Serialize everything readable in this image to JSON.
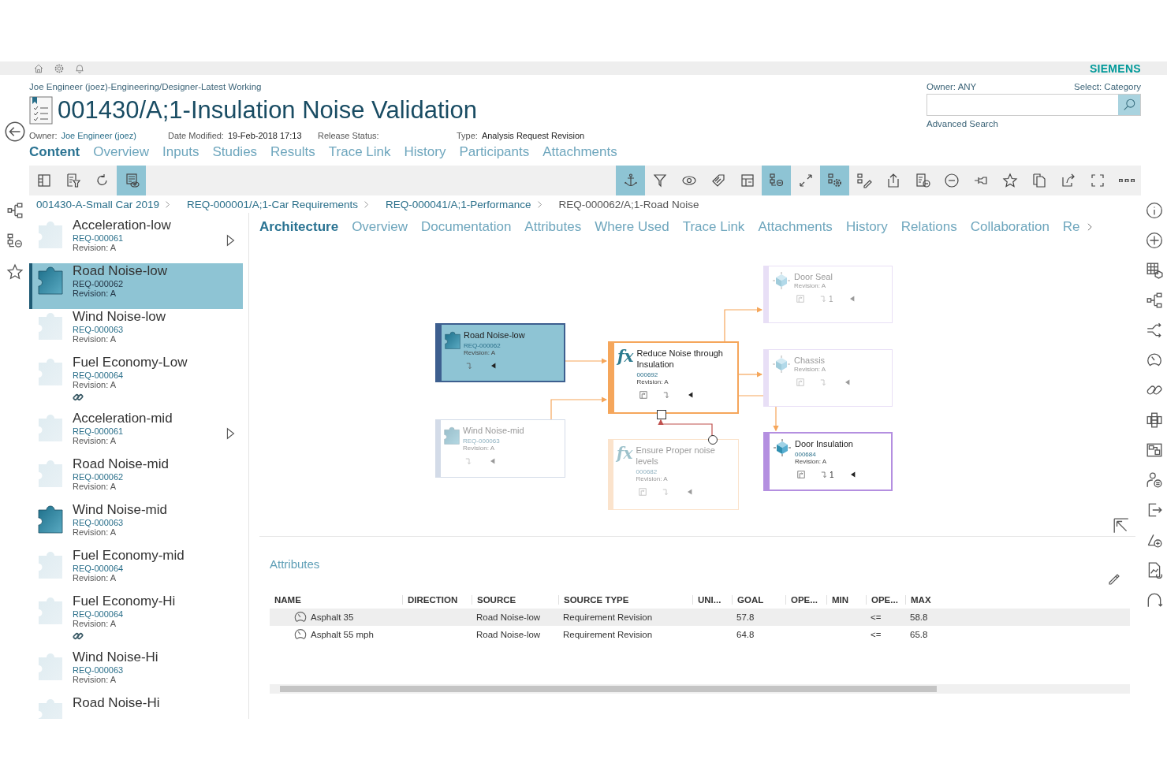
{
  "top_bar": {
    "logo": "SIEMENS"
  },
  "header": {
    "context": "Joe Engineer (joez)-Engineering/Designer-Latest Working",
    "title": "001430/A;1-Insulation Noise Validation",
    "properties": [
      {
        "label": "Owner:",
        "value": "Joe Engineer (joez)",
        "link": true
      },
      {
        "label": "Date Modified:",
        "value": "19-Feb-2018 17:13",
        "link": false
      },
      {
        "label": "Release Status:"
      },
      {
        "label": "Type:",
        "value": "Analysis Request Revision",
        "link": false
      }
    ]
  },
  "search": {
    "owner": "Owner: ANY",
    "select": "Select: Category",
    "advanced": "Advanced Search"
  },
  "page_tabs": [
    {
      "label": "Content",
      "selected": true
    },
    {
      "label": "Overview",
      "selected": false
    },
    {
      "label": "Inputs",
      "selected": false
    },
    {
      "label": "Studies",
      "selected": false
    },
    {
      "label": "Results",
      "selected": false
    },
    {
      "label": "Trace Link",
      "selected": false
    },
    {
      "label": "History",
      "selected": false
    },
    {
      "label": "Participants",
      "selected": false
    },
    {
      "label": "Attachments",
      "selected": false
    }
  ],
  "toolbar": {
    "left": [
      {
        "selected": false
      },
      {
        "selected": false
      },
      {
        "selected": false
      },
      {
        "selected": true
      }
    ],
    "right": [
      {
        "selected": true
      },
      {
        "selected": false
      },
      {
        "selected": false
      },
      {
        "selected": false
      },
      {
        "selected": false
      },
      {
        "selected": true
      },
      {
        "selected": false
      },
      {
        "selected": true
      },
      {
        "selected": false
      },
      {
        "selected": false
      },
      {
        "selected": false
      },
      {
        "selected": false
      },
      {
        "selected": false
      },
      {
        "selected": false
      },
      {
        "selected": false
      },
      {
        "selected": false
      },
      {
        "selected": false
      },
      {
        "selected": false
      }
    ]
  },
  "breadcrumb": [
    "001430-A-Small Car 2019",
    "REQ-000001/A;1-Car Requirements",
    "REQ-000041/A;1-Performance",
    "REQ-000062/A;1-Road Noise"
  ],
  "list": [
    {
      "name": "Acceleration-low",
      "id": "REQ-000061",
      "revision": "Revision:  A",
      "selected": false,
      "active": false,
      "linked": false,
      "expandable": true
    },
    {
      "name": "Road Noise-low",
      "id": "REQ-000062",
      "revision": "Revision:  A",
      "selected": true,
      "active": true,
      "linked": false,
      "expandable": false
    },
    {
      "name": "Wind Noise-low",
      "id": "REQ-000063",
      "revision": "Revision:  A",
      "selected": false,
      "active": false,
      "linked": false,
      "expandable": false
    },
    {
      "name": "Fuel Economy-Low",
      "id": "REQ-000064",
      "revision": "Revision:  A",
      "selected": false,
      "active": false,
      "linked": true,
      "expandable": false
    },
    {
      "name": "Acceleration-mid",
      "id": "REQ-000061",
      "revision": "Revision:  A",
      "selected": false,
      "active": false,
      "linked": false,
      "expandable": true
    },
    {
      "name": "Road Noise-mid",
      "id": "REQ-000062",
      "revision": "Revision:  A",
      "selected": false,
      "active": false,
      "linked": false,
      "expandable": false
    },
    {
      "name": "Wind Noise-mid",
      "id": "REQ-000063",
      "revision": "Revision:  A",
      "selected": false,
      "active": true,
      "linked": false,
      "expandable": false
    },
    {
      "name": "Fuel Economy-mid",
      "id": "REQ-000064",
      "revision": "Revision:  A",
      "selected": false,
      "active": false,
      "linked": false,
      "expandable": false
    },
    {
      "name": "Fuel Economy-Hi",
      "id": "REQ-000064",
      "revision": "Revision:  A",
      "selected": false,
      "active": false,
      "linked": true,
      "expandable": false
    },
    {
      "name": "Wind Noise-Hi",
      "id": "REQ-000063",
      "revision": "Revision:  A",
      "selected": false,
      "active": false,
      "linked": false,
      "expandable": false
    },
    {
      "name": "Road Noise-Hi",
      "selected": false,
      "active": false,
      "linked": false,
      "expandable": false
    }
  ],
  "content_tabs": [
    {
      "label": "Architecture",
      "selected": true
    },
    {
      "label": "Overview",
      "selected": false
    },
    {
      "label": "Documentation",
      "selected": false
    },
    {
      "label": "Attributes",
      "selected": false
    },
    {
      "label": "Where Used",
      "selected": false
    },
    {
      "label": "Trace Link",
      "selected": false
    },
    {
      "label": "Attachments",
      "selected": false
    },
    {
      "label": "History",
      "selected": false
    },
    {
      "label": "Relations",
      "selected": false
    },
    {
      "label": "Collaboration",
      "selected": false
    },
    {
      "label": "Re",
      "selected": false
    }
  ],
  "diagram": {
    "nodes": [
      {
        "kind": "requirement",
        "title": "Road Noise-low",
        "id": "REQ-000062",
        "revision": "Revision: A",
        "color": "#3d5f8f",
        "selected": true,
        "faded": false
      },
      {
        "kind": "requirement",
        "title": "Wind Noise-mid",
        "id": "REQ-000063",
        "revision": "Revision: A",
        "color": "#d3dbe8",
        "selected": false,
        "faded": true
      },
      {
        "kind": "function",
        "symbol": "fx",
        "title": "Reduce Noise through Insulation",
        "id": "000692",
        "revision": "Revision: A",
        "color": "#f5a65b",
        "selected": false,
        "faded": false
      },
      {
        "kind": "function",
        "symbol": "fx",
        "title": "Ensure Proper noise levels",
        "id": "000682",
        "revision": "Revision: A",
        "color": "#fbe3cc",
        "selected": false,
        "faded": true
      },
      {
        "kind": "part",
        "title": "Door Seal",
        "revision": "Revision: A",
        "count": "1",
        "color": "#e8dff6",
        "selected": false,
        "faded": true
      },
      {
        "kind": "part",
        "title": "Chassis",
        "revision": "Revision: A",
        "color": "#e8dff6",
        "selected": false,
        "faded": true
      },
      {
        "kind": "part",
        "title": "Door Insulation",
        "id": "000684",
        "revision": "Revision: A",
        "count": "1",
        "color": "#b48fe0",
        "selected": false,
        "faded": false
      }
    ]
  },
  "attributes": {
    "title": "Attributes",
    "columns": [
      "NAME",
      "DIRECTION",
      "SOURCE",
      "SOURCE TYPE",
      "UNI...",
      "GOAL",
      "OPE...",
      "MIN",
      "OPE...",
      "MAX"
    ],
    "rows": [
      {
        "selected": true,
        "cells": [
          "Asphalt 35",
          null,
          "Road Noise-low",
          "Requirement Revision",
          null,
          "57.8",
          null,
          null,
          "<=",
          "58.8"
        ]
      },
      {
        "selected": false,
        "cells": [
          "Asphalt 55 mph",
          null,
          "Road Noise-low",
          "Requirement Revision",
          null,
          "64.8",
          null,
          null,
          "<=",
          "65.8"
        ]
      }
    ]
  }
}
